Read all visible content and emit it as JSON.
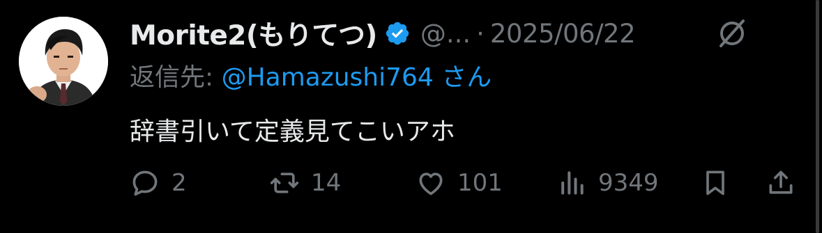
{
  "tweet": {
    "author_name": "Morite2(もりてつ)",
    "handle": "@...",
    "separator": "·",
    "date": "2025/06/22",
    "reply_label": "返信先: ",
    "reply_handle": "@Hamazushi764",
    "reply_suffix": " さん",
    "text": "辞書引いて定義見てこいアホ"
  },
  "actions": {
    "replies": "2",
    "retweets": "14",
    "likes": "101",
    "views": "9349"
  },
  "icons": {
    "verified": "verified-badge-icon",
    "grok": "grok-icon",
    "reply": "reply-icon",
    "retweet": "retweet-icon",
    "like": "heart-icon",
    "views": "views-icon",
    "bookmark": "bookmark-icon",
    "share": "share-icon"
  },
  "colors": {
    "background": "#000000",
    "text": "#e7e9ea",
    "muted": "#71767b",
    "accent": "#1d9bf0"
  }
}
